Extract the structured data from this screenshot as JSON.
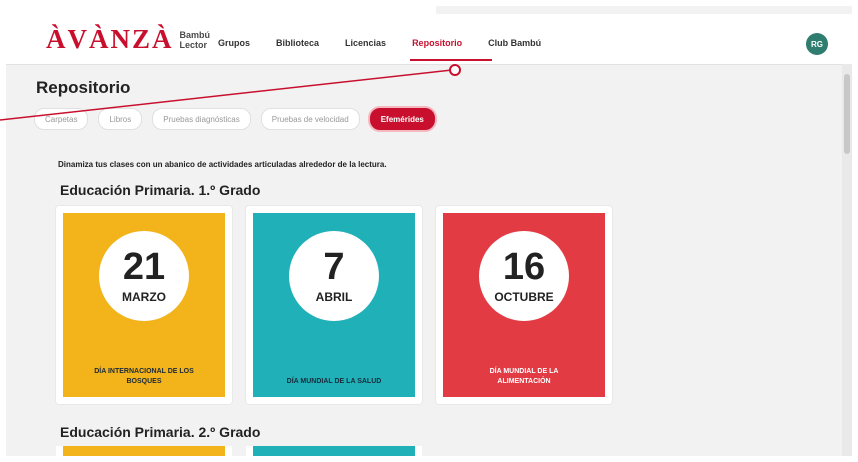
{
  "header": {
    "logo_main": "ÀVÀNZÀ",
    "logo_sub_line1": "Bambú",
    "logo_sub_line2": "Lector",
    "nav": [
      "Grupos",
      "Biblioteca",
      "Licencias",
      "Repositorio",
      "Club Bambú"
    ],
    "active_nav": "Repositorio",
    "avatar_initials": "RG"
  },
  "page": {
    "title": "Repositorio",
    "tabs": [
      "Carpetas",
      "Libros",
      "Pruebas diagnósticas",
      "Pruebas de velocidad",
      "Efemérides"
    ],
    "active_tab": "Efemérides",
    "subtitle": "Dinamiza tus clases con un abanico de actividades articuladas alrededor de la lectura."
  },
  "sections": [
    {
      "title": "Educación Primaria. 1.º Grado",
      "cards": [
        {
          "day": "21",
          "month": "MARZO",
          "caption_l1": "DÍA INTERNACIONAL DE LOS",
          "caption_l2": "BOSQUES",
          "color": "#f2b31b"
        },
        {
          "day": "7",
          "month": "ABRIL",
          "caption_l1": "DÍA MUNDIAL DE LA SALUD",
          "caption_l2": "",
          "color": "#1fb0b8"
        },
        {
          "day": "16",
          "month": "OCTUBRE",
          "caption_l1": "DÍA MUNDIAL DE LA",
          "caption_l2": "ALIMENTACIÓN",
          "color": "#e23b44"
        }
      ]
    },
    {
      "title": "Educación Primaria. 2.º Grado",
      "card_colors": [
        "#f2b31b",
        "#1fb0b8"
      ]
    }
  ],
  "colors": {
    "accent": "#c8102e"
  }
}
